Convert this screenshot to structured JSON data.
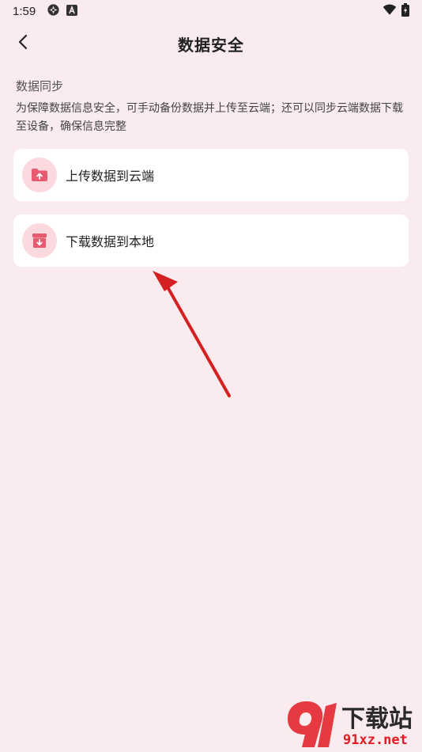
{
  "status_bar": {
    "time": "1:59",
    "left_icons": [
      "settings-icon",
      "a-badge-icon"
    ],
    "right_icons": [
      "wifi-icon",
      "battery-icon"
    ]
  },
  "app_bar": {
    "title": "数据安全",
    "back_icon": "chevron-left-icon"
  },
  "section": {
    "title": "数据同步",
    "description": "为保障数据信息安全，可手动备份数据并上传至云端；还可以同步云端数据下载至设备，确保信息完整"
  },
  "actions": [
    {
      "label": "上传数据到云端",
      "icon": "upload-folder-icon"
    },
    {
      "label": "下载数据到本地",
      "icon": "download-box-icon"
    }
  ],
  "colors": {
    "background": "#f9ebee",
    "card": "#ffffff",
    "icon_bg": "#fbd9df",
    "accent": "#e85a6f",
    "arrow": "#d42020"
  },
  "watermark": {
    "text_top": "下载站",
    "text_bottom": "91xz.net"
  }
}
